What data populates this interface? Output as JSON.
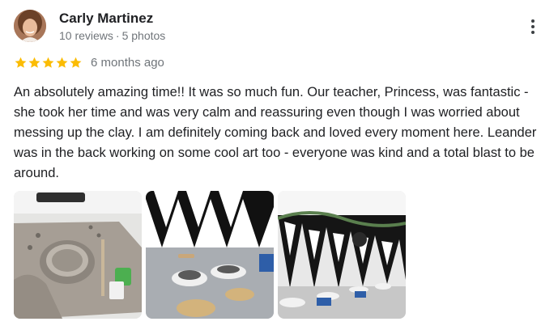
{
  "reviewer": {
    "name": "Carly Martinez",
    "reviews": "10 reviews",
    "separator": "·",
    "photos": "5 photos"
  },
  "rating": {
    "stars": 5,
    "max": 5,
    "date": "6 months ago"
  },
  "review_text": "An absolutely amazing time!! It was so much fun. Our teacher, Princess, was fantastic - she took her time and was very calm and reassuring even though I was worried about messing up the clay. I am definitely coming back and loved every moment here. Leander was in the back working on some cool art too - everyone was kind and a total blast to be around.",
  "colors": {
    "star": "#fbbc04",
    "secondary_text": "#70757a"
  },
  "icons": {
    "menu": "more-vert-icon",
    "star": "star-icon"
  }
}
